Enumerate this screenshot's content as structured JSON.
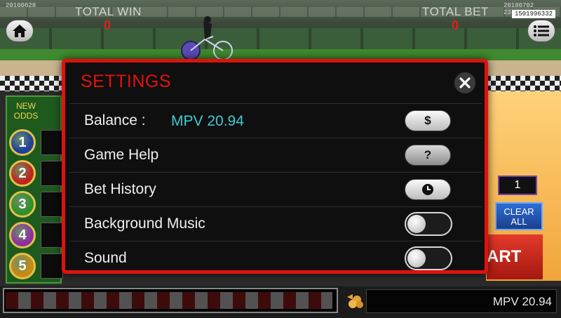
{
  "hud": {
    "stamp_left": "20160628",
    "stamp_right": "20180702 23:51:08",
    "stamp_id": "1501996332",
    "total_win_label": "TOTAL WIN",
    "total_win_value": "0",
    "total_bet_label": "TOTAL BET",
    "total_bet_value": "0"
  },
  "odds": {
    "title": "NEW ODDS",
    "balls": [
      "1",
      "2",
      "3",
      "4",
      "5"
    ],
    "ball_colors": [
      "#1f3f9a",
      "#c0241c",
      "#2f8f2a",
      "#8e2fa0",
      "#c98a14"
    ]
  },
  "right_panel": {
    "count": "1",
    "clear_label": "CLEAR ALL",
    "start_label": "ART"
  },
  "bottom": {
    "balance": "MPV 20.94"
  },
  "settings": {
    "title": "SETTINGS",
    "rows": [
      {
        "label": "Balance :",
        "value": "MPV 20.94",
        "control": "dollar-button",
        "glyph": "$"
      },
      {
        "label": "Game Help",
        "control": "help-button",
        "glyph": "?"
      },
      {
        "label": "Bet History",
        "control": "history-button",
        "glyph": "clock-icon"
      },
      {
        "label": "Background Music",
        "control": "toggle",
        "state": "off"
      },
      {
        "label": "Sound",
        "control": "toggle",
        "state": "off"
      }
    ]
  },
  "colors": {
    "modal_border": "#e0120c",
    "title": "#e4120b",
    "balance_value": "#3ccbd1",
    "hud_value": "#d7231c"
  }
}
